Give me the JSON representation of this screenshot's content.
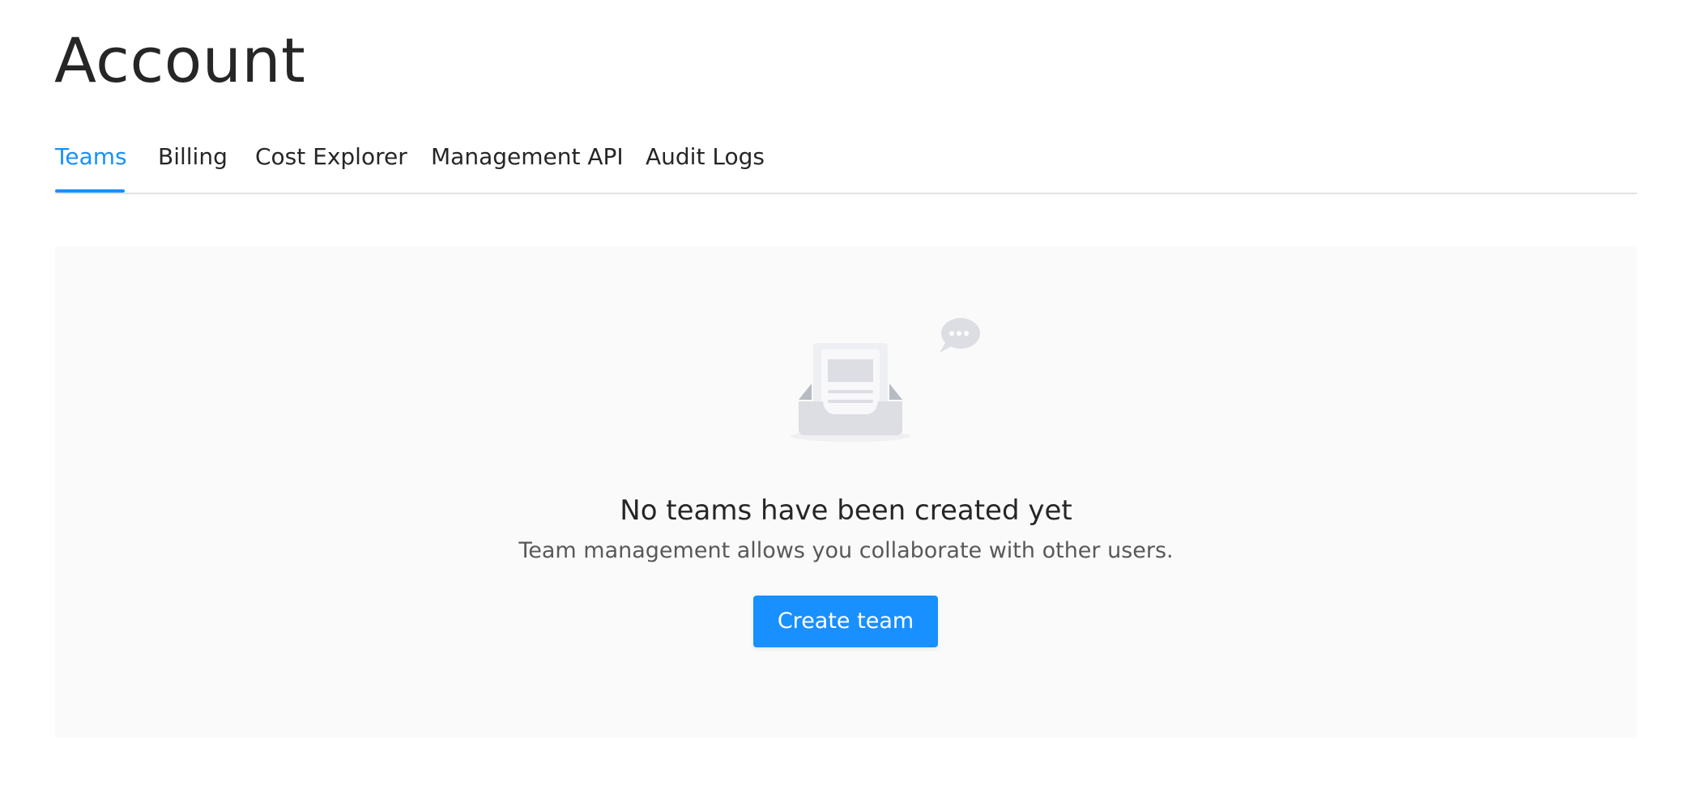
{
  "header": {
    "title": "Account"
  },
  "tabs": [
    {
      "label": "Teams",
      "active": true
    },
    {
      "label": "Billing",
      "active": false
    },
    {
      "label": "Cost Explorer",
      "active": false
    },
    {
      "label": "Management API",
      "active": false
    },
    {
      "label": "Audit Logs",
      "active": false
    }
  ],
  "empty_state": {
    "illustration_icon": "empty-inbox-icon",
    "title": "No teams have been created yet",
    "description": "Team management allows you collaborate with other users.",
    "button_label": "Create team"
  },
  "colors": {
    "accent": "#1890ff",
    "text": "#262626",
    "muted_text": "#595959",
    "panel_background": "#fafafa",
    "divider": "#e3e3e3"
  }
}
